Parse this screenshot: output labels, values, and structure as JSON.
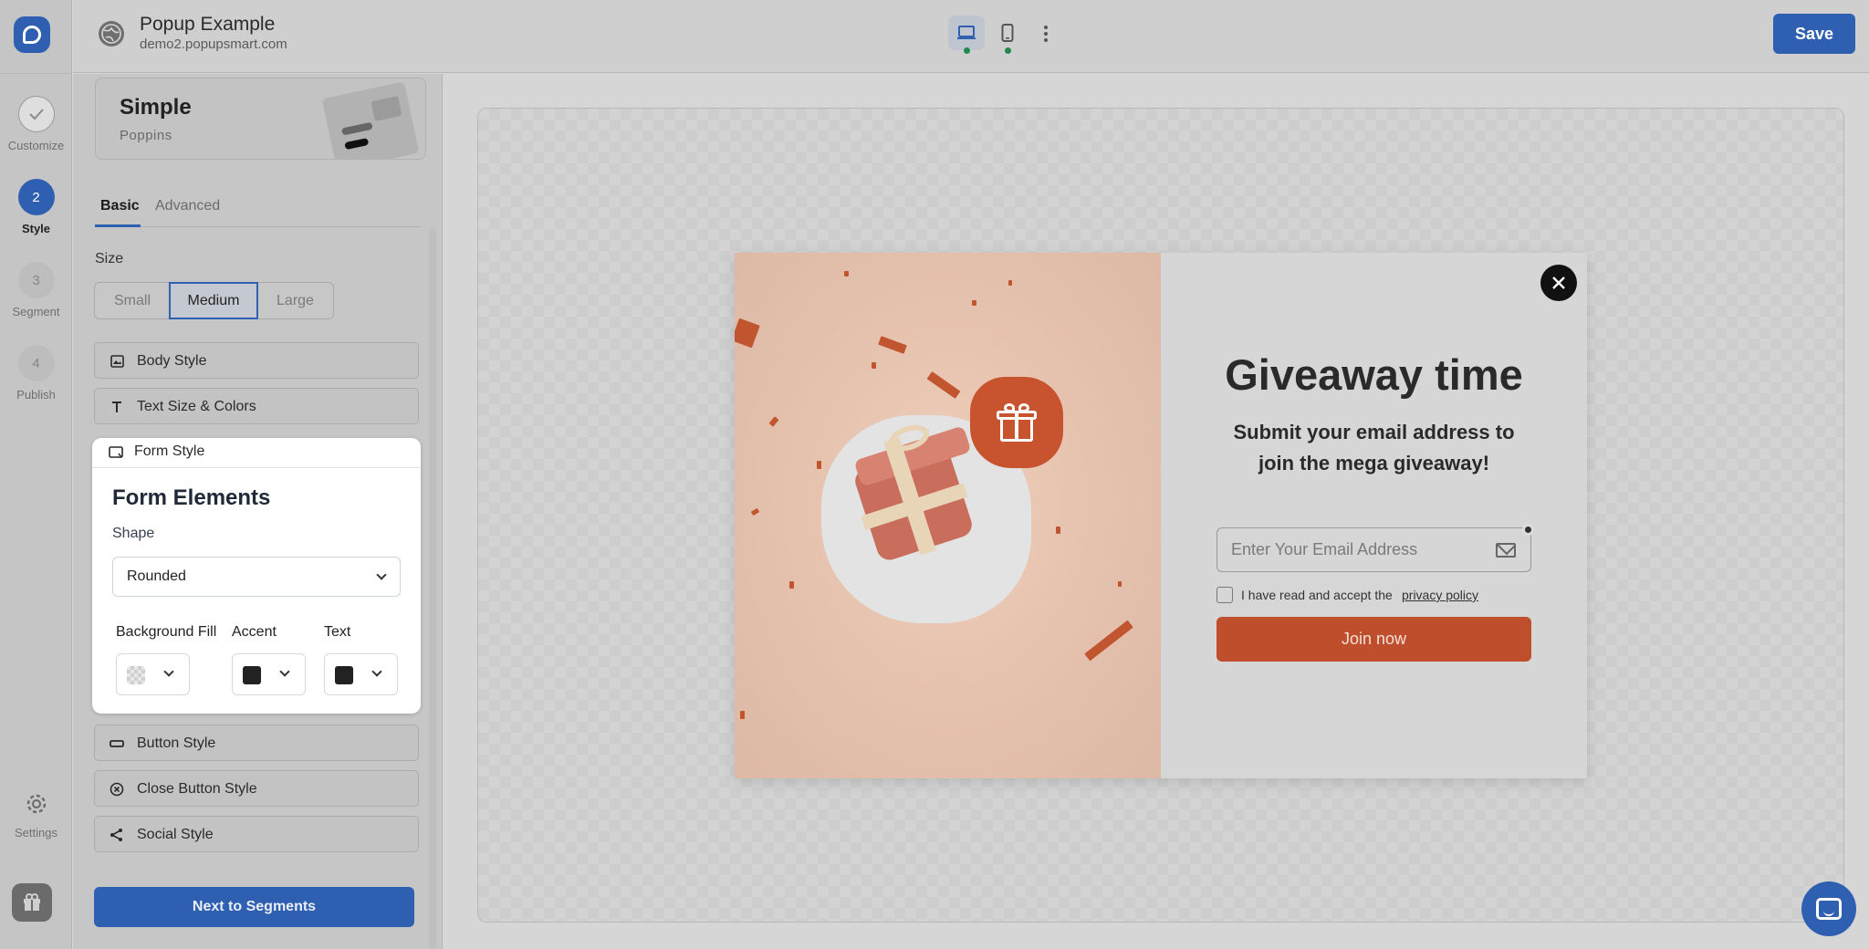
{
  "app": {
    "name": "Popupsmart",
    "colors": {
      "primary": "#2f5fb0",
      "popup_accent": "#bf4f2c",
      "popup_bg": "#f5ede7"
    }
  },
  "rail": {
    "steps": [
      {
        "number": "",
        "label": "Customize",
        "state": "done",
        "icon": "check-icon"
      },
      {
        "number": "2",
        "label": "Style",
        "state": "active"
      },
      {
        "number": "3",
        "label": "Segment",
        "state": "idle"
      },
      {
        "number": "4",
        "label": "Publish",
        "state": "idle"
      }
    ],
    "settings_label": "Settings"
  },
  "header": {
    "title": "Popup Example",
    "url": "demo2.popupsmart.com",
    "save_label": "Save",
    "devices": [
      "desktop-icon",
      "mobile-icon"
    ]
  },
  "panel": {
    "theme": {
      "name": "Simple",
      "font": "Poppins"
    },
    "tabs": [
      {
        "label": "Basic",
        "active": true
      },
      {
        "label": "Advanced",
        "active": false
      }
    ],
    "size": {
      "label": "Size",
      "options": [
        "Small",
        "Medium",
        "Large"
      ],
      "selected": "Medium"
    },
    "sections": {
      "body_style": "Body Style",
      "text_size_colors": "Text Size & Colors",
      "form_style": "Form Style",
      "button_style": "Button Style",
      "close_button_style": "Close Button Style",
      "social_style": "Social Style"
    },
    "form_elements": {
      "title": "Form Elements",
      "shape_label": "Shape",
      "shape_value": "Rounded",
      "background_fill_label": "Background Fill",
      "accent_label": "Accent",
      "text_label": "Text",
      "accent_color": "#222222",
      "text_color": "#222222",
      "background_fill_color": "transparent"
    },
    "next_label": "Next to Segments"
  },
  "popup": {
    "title": "Giveaway time",
    "subtitle": "Submit your email address to join the mega giveaway!",
    "email_placeholder": "Enter Your Email Address",
    "consent_text": "I have read and accept the",
    "consent_link": "privacy policy",
    "button_label": "Join now"
  }
}
